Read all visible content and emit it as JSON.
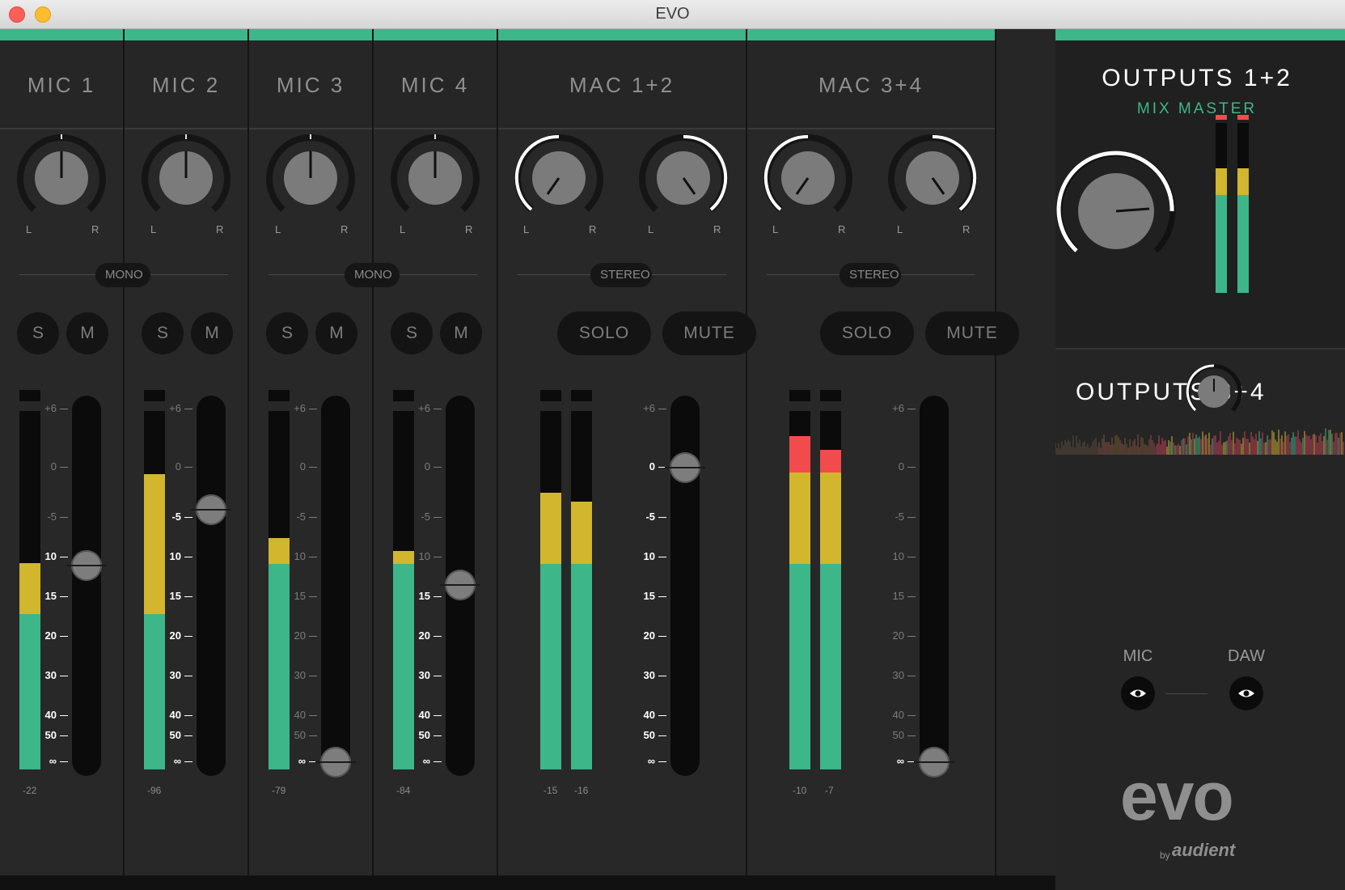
{
  "window": {
    "title": "EVO"
  },
  "colors": {
    "accent": "#3db68a",
    "meter_green": "#3db68a",
    "meter_yellow": "#d1b62e",
    "meter_red": "#f24b4b",
    "knob_arc": "#ffffff"
  },
  "channels": [
    {
      "name": "MIC 1",
      "mode": "MONO",
      "solo": "S",
      "mute": "M",
      "pan_left": "L",
      "pan_right": "R",
      "peaks": [
        "-22"
      ],
      "fader_label": "10"
    },
    {
      "name": "MIC 2",
      "mode": "",
      "solo": "S",
      "mute": "M",
      "pan_left": "L",
      "pan_right": "R",
      "peaks": [
        "-96"
      ],
      "fader_label": "-5"
    },
    {
      "name": "MIC 3",
      "mode": "MONO",
      "solo": "S",
      "mute": "M",
      "pan_left": "L",
      "pan_right": "R",
      "peaks": [
        "-79"
      ],
      "fader_label": "∞"
    },
    {
      "name": "MIC 4",
      "mode": "",
      "solo": "S",
      "mute": "M",
      "pan_left": "L",
      "pan_right": "R",
      "peaks": [
        "-84"
      ],
      "fader_label": "15"
    },
    {
      "name": "MAC 1+2",
      "mode": "STEREO",
      "solo": "SOLO",
      "mute": "MUTE",
      "pan_left": "L",
      "pan_right": "R",
      "pan_left2": "L",
      "pan_right2": "R",
      "peaks": [
        "-15",
        "-16"
      ],
      "fader_label": "0"
    },
    {
      "name": "MAC 3+4",
      "mode": "STEREO",
      "solo": "SOLO",
      "mute": "MUTE",
      "pan_left": "L",
      "pan_right": "R",
      "pan_left2": "L",
      "pan_right2": "R",
      "peaks": [
        "-10",
        "-7"
      ],
      "fader_label": "∞"
    }
  ],
  "scale": [
    "+6",
    "0",
    "-5",
    "10",
    "15",
    "20",
    "30",
    "40",
    "50",
    "∞"
  ],
  "outputs12": {
    "title": "OUTPUTS 1+2",
    "subtitle": "MIX MASTER"
  },
  "outputs34": {
    "title": "OUTPUTS 3+4"
  },
  "view": {
    "mic_label": "MIC",
    "daw_label": "DAW",
    "mic_icon": "eye-icon",
    "daw_icon": "eye-icon"
  },
  "brand": {
    "logo": "evo",
    "by": "by",
    "maker": "audient"
  }
}
